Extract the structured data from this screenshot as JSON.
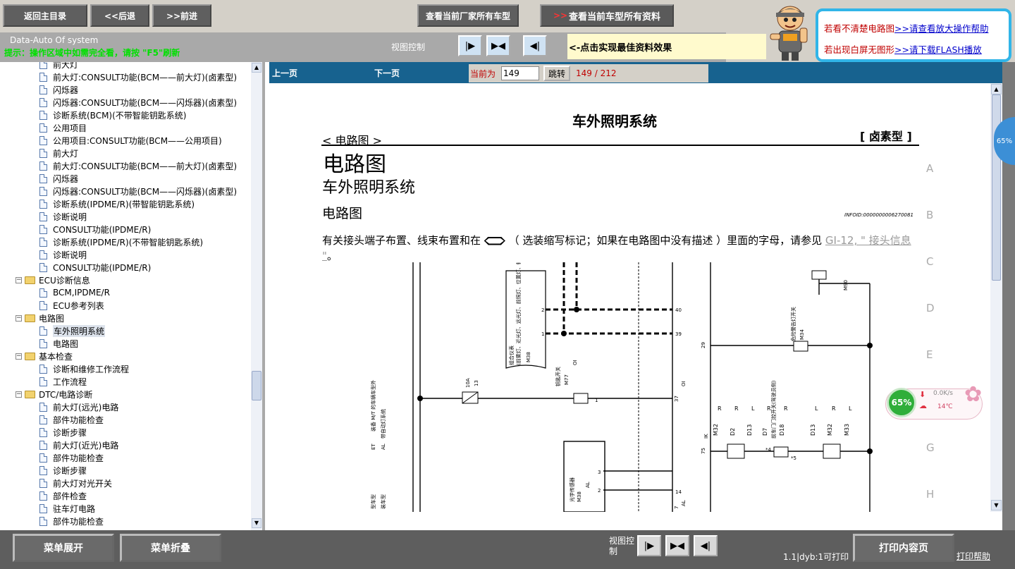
{
  "top": {
    "btn_home": "返回主目录",
    "btn_back": "<<后退",
    "btn_forward": ">>前进",
    "btn_maker_models": "查看当前厂家所有车型",
    "btn_model_all": "查看当前车型所有资料",
    "btn_model_all_prefix": ">>",
    "system_title": "Data-Auto Of system",
    "system_hint": "提示：操作区域中如需完全看，请按 \"F5\"刷新",
    "view_control_label": "视图控制",
    "tip_text": "<-点击实现最佳资料效果"
  },
  "help": {
    "line1_text": "若看不清楚电路图",
    "line1_link": ">>请查看放大操作帮助",
    "line2_text": "若出现白屏无图形",
    "line2_link": ">>请下载FLASH播放"
  },
  "tree": [
    {
      "t": "doc",
      "label": "前大灯",
      "indent": 56,
      "cut": true
    },
    {
      "t": "doc",
      "label": "前大灯:CONSULT功能(BCM——前大灯)(卤素型)",
      "indent": 56
    },
    {
      "t": "doc",
      "label": "闪烁器",
      "indent": 56
    },
    {
      "t": "doc",
      "label": "闪烁器:CONSULT功能(BCM——闪烁器)(卤素型)",
      "indent": 56
    },
    {
      "t": "doc",
      "label": "诊断系统(BCM)(不带智能钥匙系统)",
      "indent": 56
    },
    {
      "t": "doc",
      "label": "公用项目",
      "indent": 56
    },
    {
      "t": "doc",
      "label": "公用项目:CONSULT功能(BCM——公用项目)",
      "indent": 56
    },
    {
      "t": "doc",
      "label": "前大灯",
      "indent": 56
    },
    {
      "t": "doc",
      "label": "前大灯:CONSULT功能(BCM——前大灯)(卤素型)",
      "indent": 56
    },
    {
      "t": "doc",
      "label": "闪烁器",
      "indent": 56
    },
    {
      "t": "doc",
      "label": "闪烁器:CONSULT功能(BCM——闪烁器)(卤素型)",
      "indent": 56
    },
    {
      "t": "doc",
      "label": "诊断系统(IPDME/R)(带智能钥匙系统)",
      "indent": 56
    },
    {
      "t": "doc",
      "label": "诊断说明",
      "indent": 56
    },
    {
      "t": "doc",
      "label": "CONSULT功能(IPDME/R)",
      "indent": 56
    },
    {
      "t": "doc",
      "label": "诊断系统(IPDME/R)(不带智能钥匙系统)",
      "indent": 56
    },
    {
      "t": "doc",
      "label": "诊断说明",
      "indent": 56
    },
    {
      "t": "doc",
      "label": "CONSULT功能(IPDME/R)",
      "indent": 56
    },
    {
      "t": "folder",
      "label": "ECU诊断信息",
      "indent": 24
    },
    {
      "t": "doc",
      "label": "BCM,IPDME/R",
      "indent": 56
    },
    {
      "t": "doc",
      "label": "ECU参考列表",
      "indent": 56
    },
    {
      "t": "folder",
      "label": "电路图",
      "indent": 24
    },
    {
      "t": "doc",
      "label": "车外照明系统",
      "indent": 56,
      "selected": true
    },
    {
      "t": "doc",
      "label": "电路图",
      "indent": 56
    },
    {
      "t": "folder",
      "label": "基本检查",
      "indent": 24
    },
    {
      "t": "doc",
      "label": "诊断和维修工作流程",
      "indent": 56
    },
    {
      "t": "doc",
      "label": "工作流程",
      "indent": 56
    },
    {
      "t": "folder",
      "label": "DTC/电路诊断",
      "indent": 24
    },
    {
      "t": "doc",
      "label": "前大灯(远光)电路",
      "indent": 56
    },
    {
      "t": "doc",
      "label": "部件功能检查",
      "indent": 56
    },
    {
      "t": "doc",
      "label": "诊断步骤",
      "indent": 56
    },
    {
      "t": "doc",
      "label": "前大灯(近光)电路",
      "indent": 56
    },
    {
      "t": "doc",
      "label": "部件功能检查",
      "indent": 56
    },
    {
      "t": "doc",
      "label": "诊断步骤",
      "indent": 56
    },
    {
      "t": "doc",
      "label": "前大灯对光开关",
      "indent": 56
    },
    {
      "t": "doc",
      "label": "部件检查",
      "indent": 56
    },
    {
      "t": "doc",
      "label": "驻车灯电路",
      "indent": 56
    },
    {
      "t": "doc",
      "label": "部件功能检查",
      "indent": 56
    }
  ],
  "nav": {
    "prev": "上一页",
    "next": "下一页",
    "current_label": "当前为",
    "page_value": "149",
    "jump": "跳转",
    "page_status": "149 / 212"
  },
  "doc": {
    "header_title": "车外照明系统",
    "header_section": "< 电路图 >",
    "header_type": "[ 卤素型 ]",
    "h1": "电路图",
    "h2": "车外照明系统",
    "h3": "电路图",
    "infoid": "INFOID:0000000006270081",
    "para": "有关接头端子布置、线束布置和在",
    "para2": "（ 选装缩写标记；如果在电路图中没有描述 ）里面的字母，请参见",
    "para_link": "GI-12, \" 接头信息 \"",
    "para_end": "。",
    "row_letters": [
      "A",
      "B",
      "C",
      "D",
      "E",
      "F",
      "G",
      "H"
    ]
  },
  "diagram": {
    "fuse_amp": "10A",
    "fuse_no": "13",
    "conn_m38": "M38",
    "conn_m77": "M77",
    "conn_m34": "M34",
    "conn_m90": "M90",
    "conn_oi": "OI",
    "conn_al": "AL",
    "conn_et": "ET",
    "conn_ik": "IK",
    "pin_40": "40",
    "pin_39": "39",
    "pin_37": "37",
    "pin_29": "29",
    "pin_75": "75",
    "pin_14": "14",
    "pin_7": "7",
    "pin_2a": "2",
    "pin_1a": "1",
    "pin_2b": "2",
    "pin_1b": "1",
    "pin_3": "3",
    "pin_2c": "2",
    "pin_50": "50",
    "pin_13": "13",
    "lbl_combo_meter": "组合仪表",
    "lbl_combo_sub": "(前雾灯、近光灯、远光灯、前照灯、位置灯、转向信号灯)",
    "lbl_key_switch": "钥匙开关",
    "lbl_hazard": "危险警告灯开关",
    "lbl_door_switch": "前车门门控开关(驾驶员侧)",
    "lbl_mt": "装备 M/T 的车辆车型外",
    "lbl_auto_light": "带自动灯系统",
    "lbl_light_sensor": "光学传感器",
    "lbl_model1": "型车型",
    "lbl_model2": "装车型",
    "r1": "R",
    "r2": "R",
    "l1": "L",
    "r3": "R",
    "r4": "R",
    "l2": "L",
    "r5": "R",
    "l3": "L",
    "c_m32": "M32",
    "c_d2": "D2",
    "c_d13": "D13",
    "c_d7": "D7",
    "c_d18": "D18",
    "c_d13b": "D13",
    "c_m32b": "M32",
    "c_m33": "M33",
    "star4": "*4",
    "star5": "*5"
  },
  "widget": {
    "percent": "65%",
    "speed": "0.0K/s",
    "temp": "14℃",
    "edge_percent": "65%"
  },
  "bottom": {
    "btn_expand": "菜单展开",
    "btn_collapse": "菜单折叠",
    "view_control_label": "视图控制",
    "status": "1.1|dyb:1可打印",
    "btn_print": "打印内容页",
    "print_help": "打印帮助"
  }
}
